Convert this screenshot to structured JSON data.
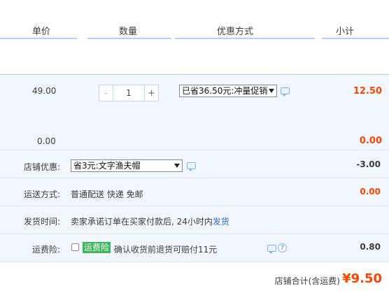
{
  "header": {
    "col_price": "单价",
    "col_qty": "数量",
    "col_promo": "优惠方式",
    "col_subtotal": "小计"
  },
  "item": {
    "price": "49.00",
    "qty_minus": "-",
    "qty_value": "1",
    "qty_plus": "+",
    "promo_selected": "已省36.50元:冲量促销",
    "subtotal": "12.50",
    "extra_price": "0.00",
    "extra_subtotal": "0.00"
  },
  "shop": {
    "discount_label": "店铺优惠:",
    "discount_selected": "省3元:文字渔夫帽",
    "discount_amount": "-3.00",
    "shipping_label": "运送方式:",
    "shipping_method": "普通配送 快递 免邮",
    "shipping_amount": "0.00",
    "delivery_label": "发货时间:",
    "delivery_text": "卖家承诺订单在买家付款后, 24小时内",
    "delivery_link": "发货",
    "insurance_label": "运费险:",
    "insurance_badge": "运费险",
    "insurance_text": "确认收货前退货可赔付11元",
    "insurance_amount": "0.80"
  },
  "total": {
    "label": "店铺合计(含运费)",
    "value": "¥9.50"
  },
  "colors": {
    "accent_red": "#ff4400",
    "header_line": "#b2d1ff",
    "row_bg": "#f2f7ff",
    "badge_green": "#3eb55b"
  }
}
